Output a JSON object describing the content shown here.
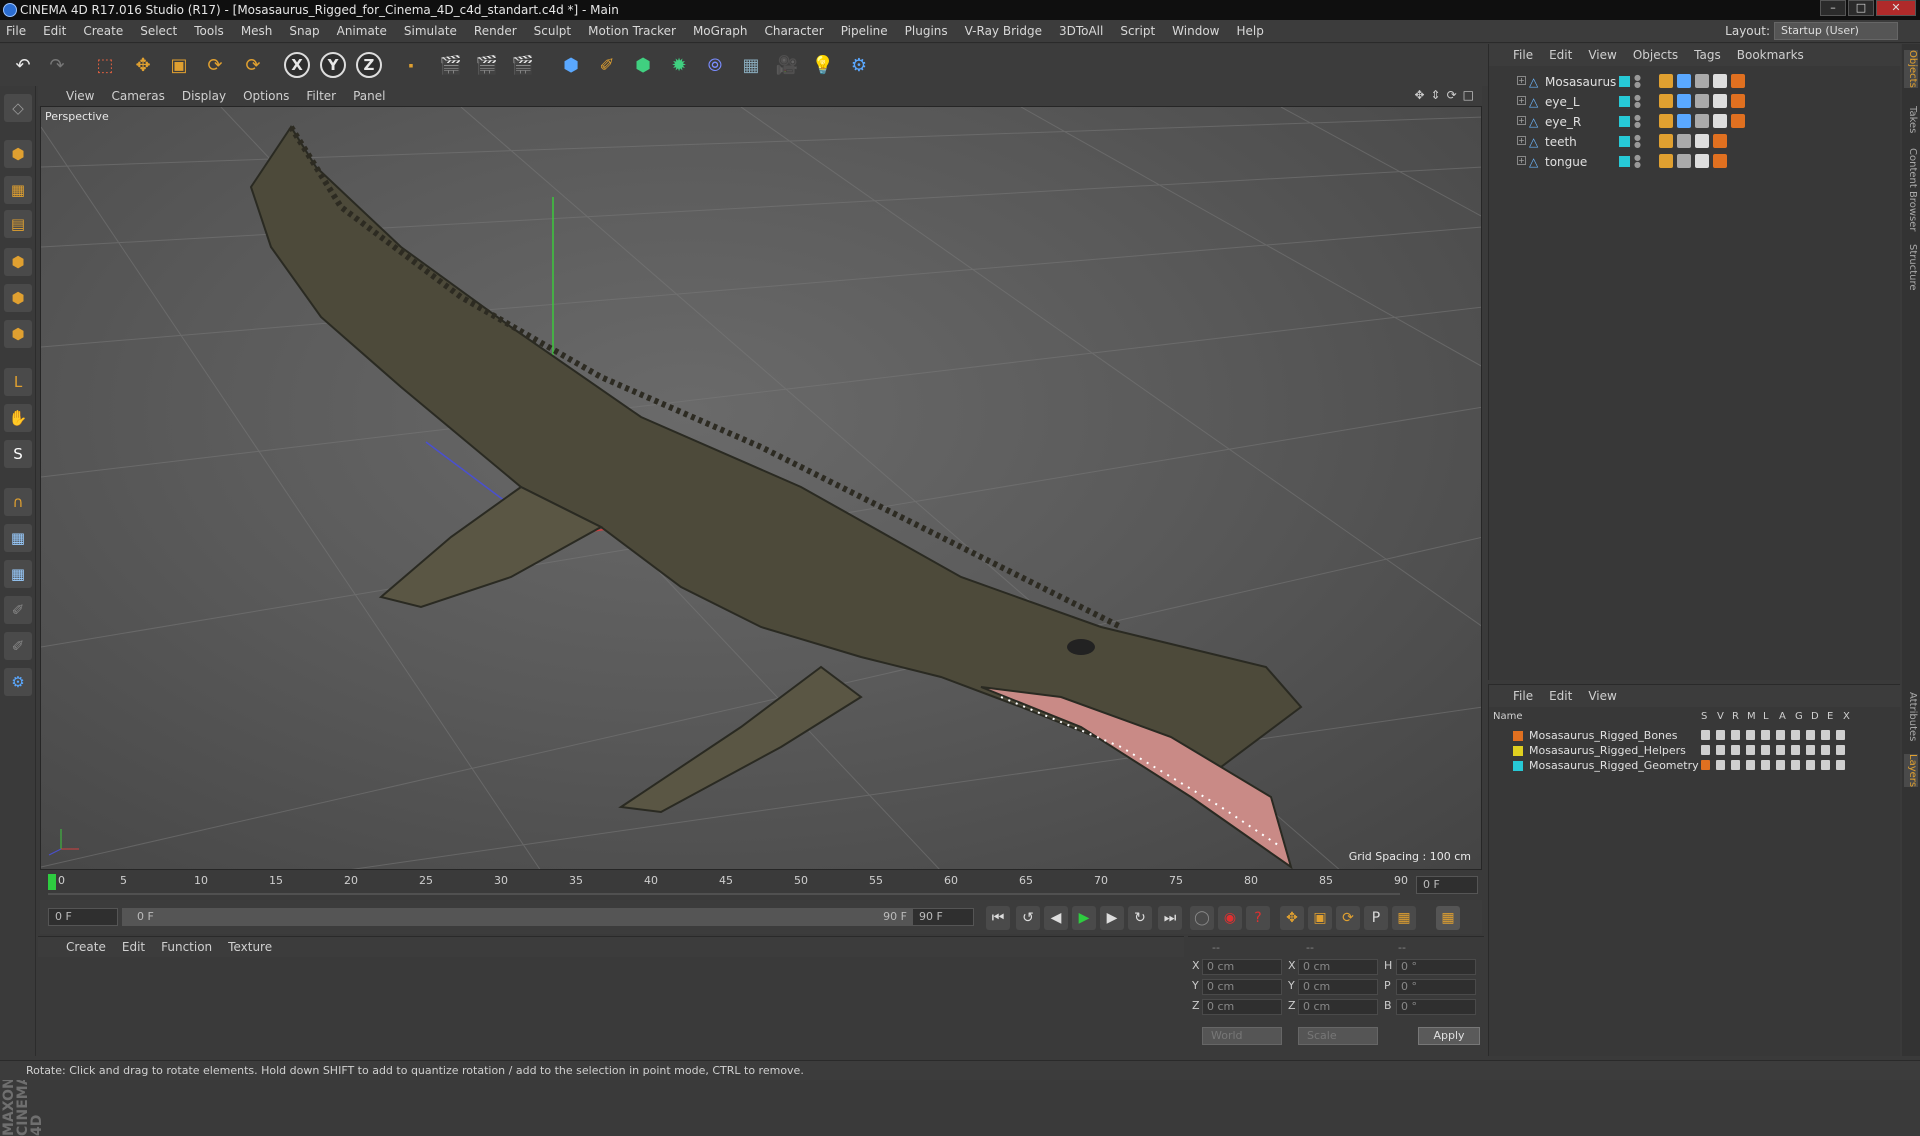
{
  "window": {
    "title": "CINEMA 4D R17.016 Studio (R17) - [Mosasaurus_Rigged_for_Cinema_4D_c4d_standart.c4d *] - Main",
    "buttons": {
      "minimize": "–",
      "maximize": "□",
      "close": "✕"
    }
  },
  "menubar": {
    "items": [
      "File",
      "Edit",
      "Create",
      "Select",
      "Tools",
      "Mesh",
      "Snap",
      "Animate",
      "Simulate",
      "Render",
      "Sculpt",
      "Motion Tracker",
      "MoGraph",
      "Character",
      "Pipeline",
      "Plugins",
      "V-Ray Bridge",
      "3DToAll",
      "Script",
      "Window",
      "Help"
    ],
    "layout_label": "Layout:",
    "layout_value": "Startup (User)"
  },
  "toolbar": {
    "axis_x": "X",
    "axis_y": "Y",
    "axis_z": "Z"
  },
  "viewport": {
    "menu": [
      "View",
      "Cameras",
      "Display",
      "Options",
      "Filter",
      "Panel"
    ],
    "label": "Perspective",
    "grid_spacing": "Grid Spacing : 100 cm"
  },
  "timeline": {
    "ticks": [
      "0",
      "5",
      "10",
      "15",
      "20",
      "25",
      "30",
      "35",
      "40",
      "45",
      "50",
      "55",
      "60",
      "65",
      "70",
      "75",
      "80",
      "85",
      "90"
    ],
    "current_frame_field": "0 F",
    "start_field": "0 F",
    "range_start": "0 F",
    "range_end": "90 F",
    "end_field": "90 F"
  },
  "material_panel": {
    "menu": [
      "Create",
      "Edit",
      "Function",
      "Texture"
    ]
  },
  "coordinates": {
    "header": [
      "--",
      "--",
      "--"
    ],
    "rows": [
      {
        "a": "X",
        "av": "0 cm",
        "b": "X",
        "bv": "0 cm",
        "c": "H",
        "cv": "0 °"
      },
      {
        "a": "Y",
        "av": "0 cm",
        "b": "Y",
        "bv": "0 cm",
        "c": "P",
        "cv": "0 °"
      },
      {
        "a": "Z",
        "av": "0 cm",
        "b": "Z",
        "bv": "0 cm",
        "c": "B",
        "cv": "0 °"
      }
    ],
    "mode_select": "World",
    "size_select": "Scale",
    "apply": "Apply"
  },
  "object_manager": {
    "menu": [
      "File",
      "Edit",
      "View",
      "Objects",
      "Tags",
      "Bookmarks"
    ],
    "objects": [
      {
        "name": "Mosasaurus"
      },
      {
        "name": "eye_L"
      },
      {
        "name": "eye_R"
      },
      {
        "name": "teeth"
      },
      {
        "name": "tongue"
      }
    ]
  },
  "layer_manager": {
    "menu": [
      "File",
      "Edit",
      "View"
    ],
    "columns": [
      "Name",
      "S",
      "V",
      "R",
      "M",
      "L",
      "A",
      "G",
      "D",
      "E",
      "X"
    ],
    "layers": [
      {
        "name": "Mosasaurus_Rigged_Bones",
        "color": "#e07020"
      },
      {
        "name": "Mosasaurus_Rigged_Helpers",
        "color": "#e0d020"
      },
      {
        "name": "Mosasaurus_Rigged_Geometry",
        "color": "#27c9d6"
      }
    ]
  },
  "side_tabs": [
    "Objects",
    "Takes",
    "Content Browser",
    "Structure",
    "Attributes",
    "Layers"
  ],
  "logo": {
    "text": "MAXON CINEMA 4D"
  },
  "status": "Rotate: Click and drag to rotate elements. Hold down SHIFT to add to quantize rotation / add to the selection in point mode, CTRL to remove.",
  "colors": {
    "accent": "#e0a030",
    "object_color": "#27c9d6",
    "playhead": "#2ecc40"
  }
}
